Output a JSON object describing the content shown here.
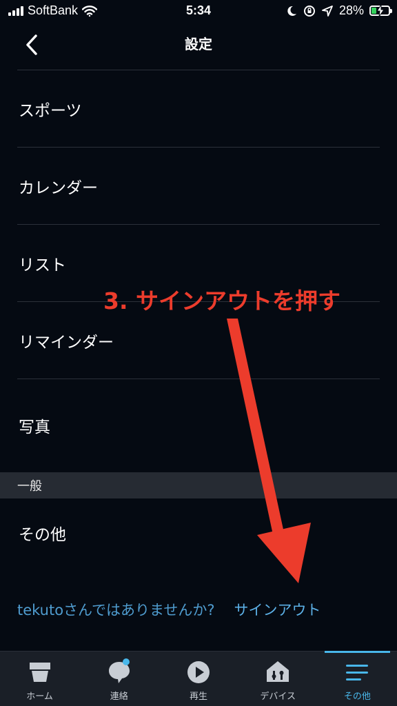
{
  "status_bar": {
    "carrier": "SoftBank",
    "time": "5:34",
    "battery_percent": "28%",
    "battery_level": 0.28,
    "icons": [
      "signal-icon",
      "wifi-icon",
      "moon-icon",
      "rotation-lock-icon",
      "location-icon",
      "battery-charging-icon"
    ]
  },
  "header": {
    "title": "設定",
    "back_icon": "chevron-left-icon"
  },
  "list": {
    "items": [
      {
        "label": "スポーツ"
      },
      {
        "label": "カレンダー"
      },
      {
        "label": "リスト"
      },
      {
        "label": "リマインダー"
      },
      {
        "label": "写真"
      }
    ]
  },
  "section": {
    "title": "一般"
  },
  "other": {
    "label": "その他"
  },
  "signout": {
    "prompt": "tekutoさんではありませんか?",
    "link": "サインアウト"
  },
  "annotation": {
    "text": "3. サインアウトを押す",
    "color": "#ec3c2c"
  },
  "tab_bar": {
    "tabs": [
      {
        "label": "ホーム",
        "icon": "home-icon"
      },
      {
        "label": "連絡",
        "icon": "chat-icon"
      },
      {
        "label": "再生",
        "icon": "play-icon"
      },
      {
        "label": "デバイス",
        "icon": "devices-icon"
      },
      {
        "label": "その他",
        "icon": "menu-icon"
      }
    ],
    "active_index": 4,
    "accent_color": "#49b7ea"
  }
}
